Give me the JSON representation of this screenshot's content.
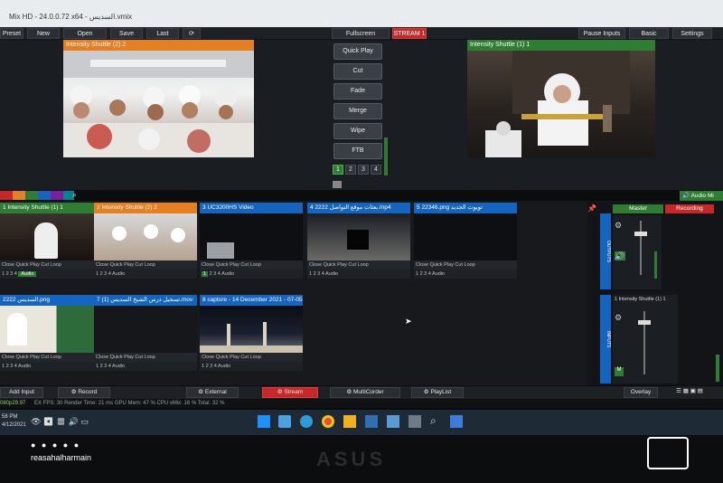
{
  "window": {
    "title": "Mix HD - 24.0.0.72 x64 - السديس.vmix"
  },
  "menubar": {
    "preset": "Preset",
    "new": "New",
    "open": "Open",
    "save": "Save",
    "last": "Last",
    "fullscreen": "Fullscreen",
    "stream_badge": "STREAM 1",
    "pause_inputs": "Pause Inputs",
    "basic": "Basic",
    "settings": "Settings"
  },
  "preview": {
    "title": "Intensity Shuttle (2) 2"
  },
  "output": {
    "title": "Intensity Shuttle (1) 1"
  },
  "transitions": {
    "quick_play": "Quick Play",
    "cut": "Cut",
    "fade": "Fade",
    "merge": "Merge",
    "wipe": "Wipe",
    "ftb": "FTB",
    "numbers": [
      "1",
      "2",
      "3",
      "4"
    ]
  },
  "audio_mixer": {
    "label": "Audio Mi"
  },
  "inputs": [
    {
      "num": "1",
      "title": "Intensity Shuttle (1) 1",
      "head": "green",
      "close": "Close",
      "quick_play": "Quick Play",
      "cut": "Cut",
      "loop": "Loop",
      "audio": "Audio"
    },
    {
      "num": "2",
      "title": "Intensity Shuttle (2) 2",
      "head": "orange",
      "close": "Close",
      "quick_play": "Quick Play",
      "cut": "Cut",
      "loop": "Loop",
      "audio": "Audio"
    },
    {
      "num": "3",
      "title": "UC3200HS Video",
      "head": "blue",
      "close": "Close",
      "quick_play": "Quick Play",
      "cut": "Cut",
      "loop": "Loop",
      "audio": "Audio"
    },
    {
      "num": "4",
      "title": "2222 بعثات موقع التواصل.mp4",
      "head": "blue",
      "close": "Close",
      "quick_play": "Quick Play",
      "cut": "Cut",
      "loop": "Loop",
      "audio": "Audio"
    },
    {
      "num": "5",
      "title": "22346.png تويوت الجديد",
      "head": "blue",
      "close": "Close",
      "quick_play": "Quick Play",
      "cut": "Cut",
      "loop": "Loop",
      "audio": "Audio"
    },
    {
      "num": "",
      "title": "2222 السديس.png",
      "head": "blue",
      "close": "Close",
      "quick_play": "Quick Play",
      "cut": "Cut",
      "loop": "Loop",
      "audio": "Audio"
    },
    {
      "num": "7",
      "title": "تسجيل درس الشيخ السديس (1).mov",
      "head": "blue",
      "close": "Close",
      "quick_play": "Quick Play",
      "cut": "Cut",
      "loop": "Loop",
      "audio": "Audio"
    },
    {
      "num": "8",
      "title": "capture - 14 December 2021 - 07-05",
      "head": "blue",
      "close": "Close",
      "quick_play": "Quick Play",
      "cut": "Cut",
      "loop": "Loop",
      "audio": "Audio"
    }
  ],
  "mixer": {
    "master": "Master",
    "recording": "Recording",
    "outputs": "OUTPUTS",
    "inputs": "INPUTS",
    "channel": "Intensity Shuttle (1) 1",
    "channel_num": "1",
    "m": "M"
  },
  "bottombar": {
    "add_input": "Add Input",
    "record": "Record",
    "external": "External",
    "stream": "Stream",
    "multicorder": "MultiCorder",
    "playlist": "PlayList",
    "overlay": "Overlay"
  },
  "statusbar": {
    "resolution": "080p29.97",
    "ex": "EX",
    "fps_label": "FPS:",
    "fps": "30",
    "render_label": "Render Time:",
    "render": "21 ms",
    "gpu_label": "GPU Mem:",
    "gpu": "47 %",
    "cpu_label": "CPU vMix:",
    "cpu": "16 %",
    "total_label": "Total:",
    "total": "32 %"
  },
  "taskbar": {
    "time": "58 PM",
    "date": "4/12/2021"
  },
  "watermark": {
    "handle": "reasahalharmain",
    "brand": "ASUS"
  },
  "colors": {
    "accent_green": "#2e7d32",
    "accent_orange": "#e67e22",
    "accent_blue": "#1565c0",
    "stream_red": "#c62828"
  }
}
